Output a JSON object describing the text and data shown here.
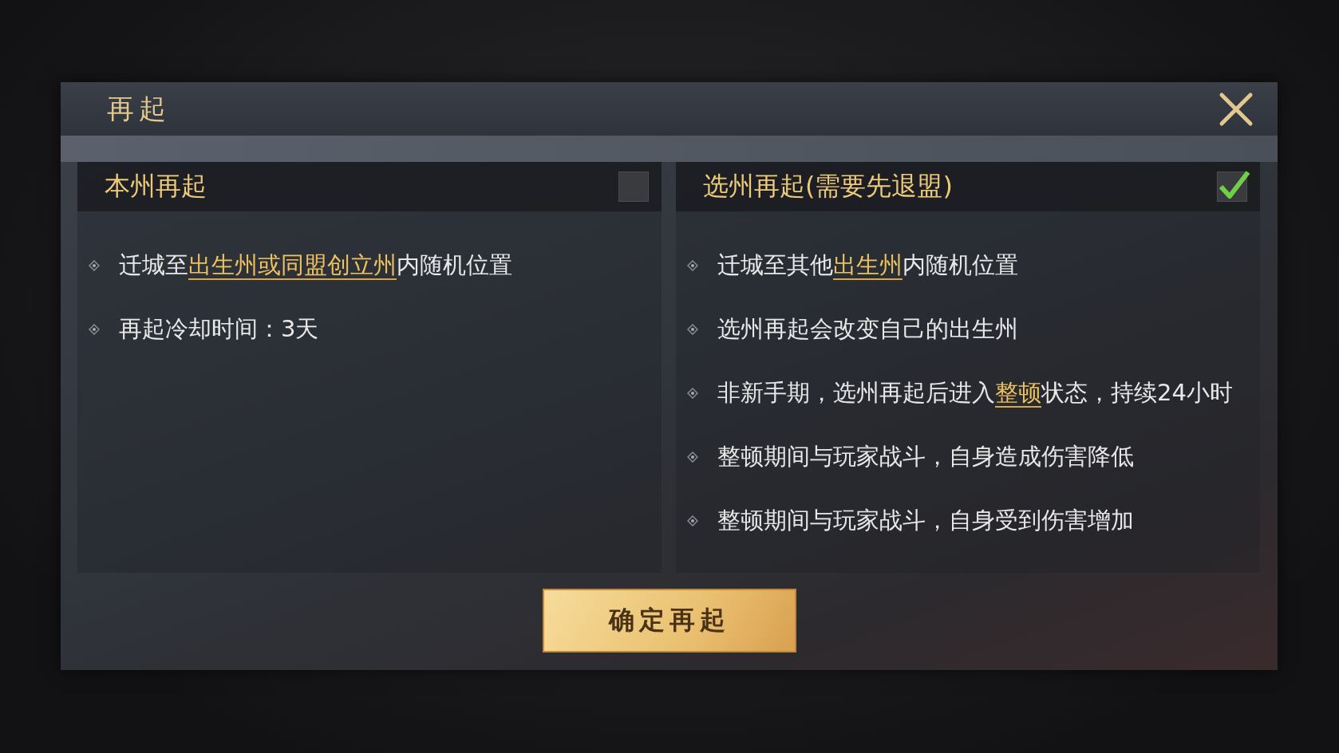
{
  "dialog": {
    "title": "再起"
  },
  "options": [
    {
      "title": "本州再起",
      "selected": false,
      "items": [
        [
          {
            "text": "迁城至",
            "highlight": false
          },
          {
            "text": "出生州或同盟创立州",
            "highlight": true
          },
          {
            "text": "内随机位置",
            "highlight": false
          }
        ],
        [
          {
            "text": "再起冷却时间：3天",
            "highlight": false
          }
        ]
      ]
    },
    {
      "title": "选州再起(需要先退盟)",
      "selected": true,
      "items": [
        [
          {
            "text": "迁城至其他",
            "highlight": false
          },
          {
            "text": "出生州",
            "highlight": true
          },
          {
            "text": "内随机位置",
            "highlight": false
          }
        ],
        [
          {
            "text": "选州再起会改变自己的出生州",
            "highlight": false
          }
        ],
        [
          {
            "text": "非新手期，选州再起后进入",
            "highlight": false
          },
          {
            "text": "整顿",
            "highlight": true
          },
          {
            "text": "状态，持续24小时",
            "highlight": false
          }
        ],
        [
          {
            "text": "整顿期间与玩家战斗，自身造成伤害降低",
            "highlight": false
          }
        ],
        [
          {
            "text": "整顿期间与玩家战斗，自身受到伤害增加",
            "highlight": false
          }
        ]
      ]
    }
  ],
  "confirm_button": "确定再起"
}
